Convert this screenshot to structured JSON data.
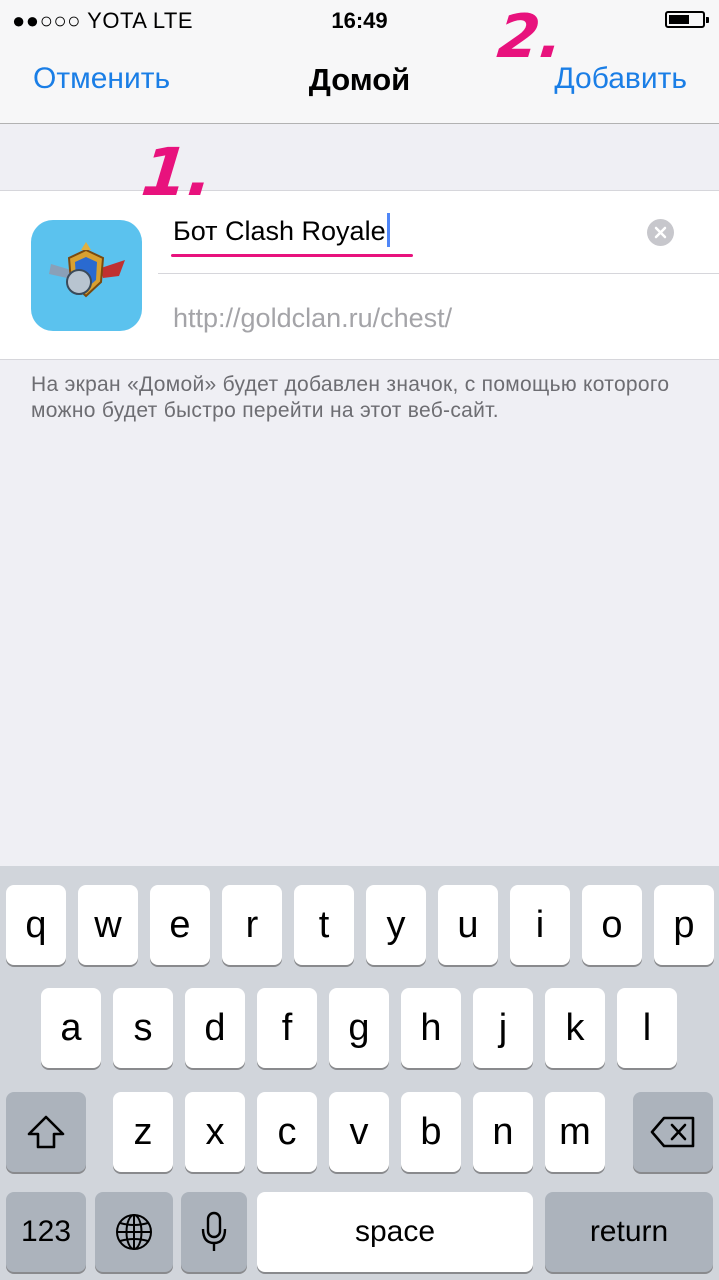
{
  "status_bar": {
    "carrier": "●●○○○ YOTA   LTE",
    "time": "16:49"
  },
  "nav": {
    "cancel_label": "Отменить",
    "title": "Домой",
    "add_label": "Добавить"
  },
  "annotations": {
    "step1": "1.",
    "step2": "2."
  },
  "form": {
    "name_value": "Бот Clash Royale",
    "url_value": "http://goldclan.ru/chest/",
    "icon_name": "clash-royale-app-icon"
  },
  "footnote": "На экран «Домой» будет добавлен значок, с помощью которого можно будет быстро перейти на этот веб-сайт.",
  "keyboard": {
    "row1": [
      "q",
      "w",
      "e",
      "r",
      "t",
      "y",
      "u",
      "i",
      "o",
      "p"
    ],
    "row2": [
      "a",
      "s",
      "d",
      "f",
      "g",
      "h",
      "j",
      "k",
      "l"
    ],
    "row3": [
      "z",
      "x",
      "c",
      "v",
      "b",
      "n",
      "m"
    ],
    "numbers_label": "123",
    "space_label": "space",
    "return_label": "return",
    "icons": {
      "shift": "shift-icon",
      "delete": "backspace-icon",
      "globe": "globe-icon",
      "mic": "microphone-icon"
    }
  },
  "colors": {
    "accent": "#1a7ee6",
    "annotation": "#e8127d",
    "icon_bg": "#5bc2ee"
  }
}
